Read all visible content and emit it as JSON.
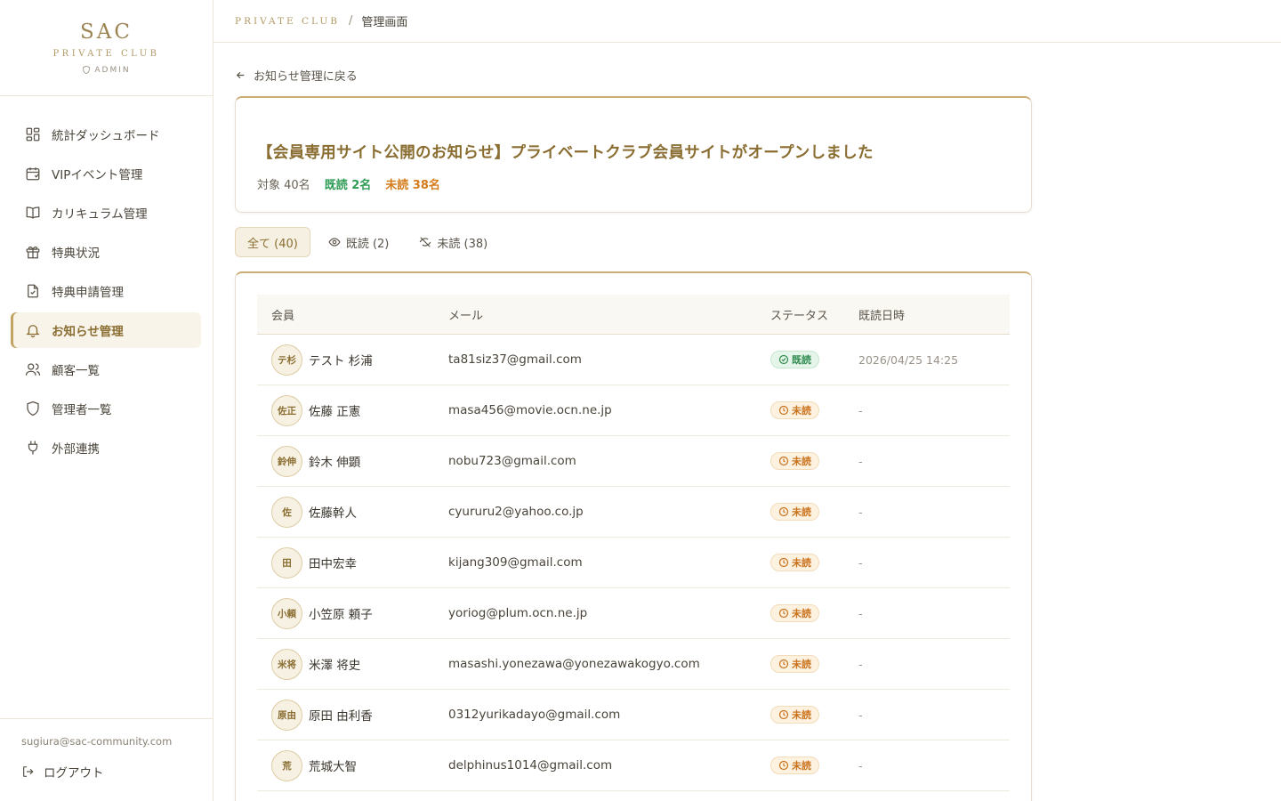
{
  "brand": {
    "title": "SAC",
    "subtitle": "PRIVATE CLUB",
    "admin": "ADMIN"
  },
  "nav": [
    {
      "label": "統計ダッシュボード",
      "icon": "dashboard-grid-icon"
    },
    {
      "label": "VIPイベント管理",
      "icon": "calendar-icon"
    },
    {
      "label": "カリキュラム管理",
      "icon": "book-icon"
    },
    {
      "label": "特典状況",
      "icon": "gift-icon"
    },
    {
      "label": "特典申請管理",
      "icon": "file-check-icon"
    },
    {
      "label": "お知らせ管理",
      "icon": "bell-icon",
      "active": true
    },
    {
      "label": "顧客一覧",
      "icon": "users-icon"
    },
    {
      "label": "管理者一覧",
      "icon": "shield-icon"
    },
    {
      "label": "外部連携",
      "icon": "plug-icon"
    }
  ],
  "footer": {
    "email": "sugiura@sac-community.com",
    "logout": "ログアウト"
  },
  "breadcrumb": {
    "club": "PRIVATE CLUB",
    "separator": "/",
    "page": "管理画面"
  },
  "back_link": "お知らせ管理に戻る",
  "notice": {
    "title": "【会員専用サイト公開のお知らせ】プライベートクラブ会員サイトがオープンしました",
    "target": "対象 40名",
    "read": "既読 2名",
    "unread": "未読 38名"
  },
  "tabs": [
    {
      "label": "全て (40)",
      "icon": "",
      "active": true
    },
    {
      "label": "既読 (2)",
      "icon": "eye-icon"
    },
    {
      "label": "未読 (38)",
      "icon": "eye-off-icon"
    }
  ],
  "table": {
    "headers": {
      "member": "会員",
      "mail": "メール",
      "status": "ステータス",
      "date": "既読日時"
    },
    "rows": [
      {
        "initials": "テ杉",
        "name": "テスト 杉浦",
        "mail": "ta81siz37@gmail.com",
        "status": "既読",
        "read": true,
        "date": "2026/04/25 14:25"
      },
      {
        "initials": "佐正",
        "name": "佐藤 正憲",
        "mail": "masa456@movie.ocn.ne.jp",
        "status": "未読",
        "read": false,
        "date": "-"
      },
      {
        "initials": "鈴伸",
        "name": "鈴木 伸顕",
        "mail": "nobu723@gmail.com",
        "status": "未読",
        "read": false,
        "date": "-"
      },
      {
        "initials": "佐",
        "name": "佐藤幹人",
        "mail": "cyururu2@yahoo.co.jp",
        "status": "未読",
        "read": false,
        "date": "-"
      },
      {
        "initials": "田",
        "name": "田中宏幸",
        "mail": "kijang309@gmail.com",
        "status": "未読",
        "read": false,
        "date": "-"
      },
      {
        "initials": "小頼",
        "name": "小笠原 頼子",
        "mail": "yoriog@plum.ocn.ne.jp",
        "status": "未読",
        "read": false,
        "date": "-"
      },
      {
        "initials": "米将",
        "name": "米澤 将史",
        "mail": "masashi.yonezawa@yonezawakogyo.com",
        "status": "未読",
        "read": false,
        "date": "-"
      },
      {
        "initials": "原由",
        "name": "原田 由利香",
        "mail": "0312yurikadayo@gmail.com",
        "status": "未読",
        "read": false,
        "date": "-"
      },
      {
        "initials": "荒",
        "name": "荒城大智",
        "mail": "delphinus1014@gmail.com",
        "status": "未読",
        "read": false,
        "date": "-"
      }
    ]
  },
  "colors": {
    "gold": "#9c8452",
    "read": "#2e9b55",
    "unread": "#d47b1a"
  }
}
